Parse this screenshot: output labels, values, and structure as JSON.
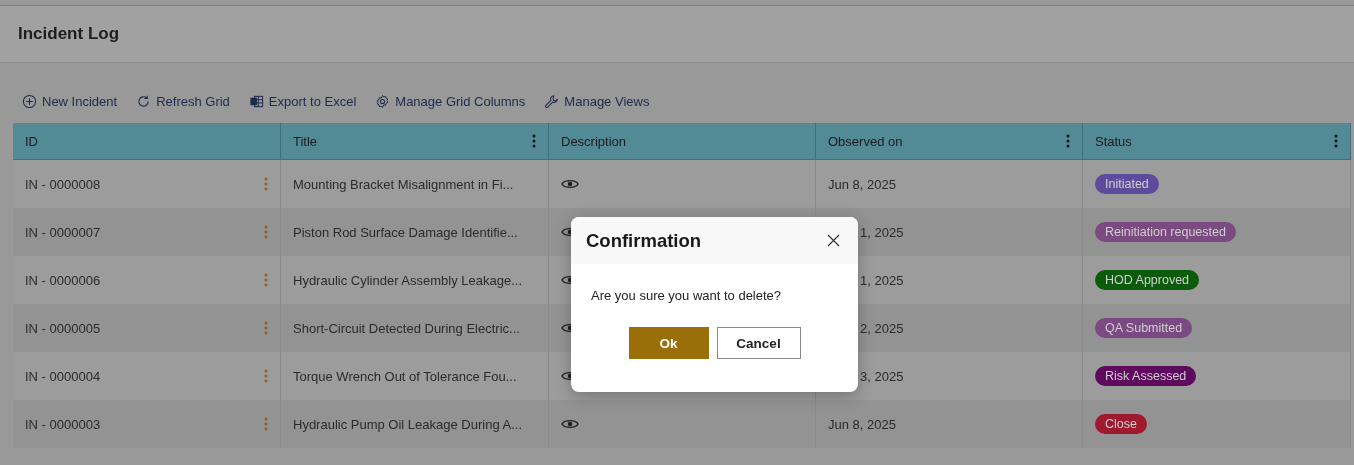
{
  "page": {
    "title": "Incident Log"
  },
  "toolbar": [
    {
      "kind": "add",
      "label": "New Incident"
    },
    {
      "kind": "refresh",
      "label": "Refresh Grid"
    },
    {
      "kind": "excel",
      "label": "Export to Excel"
    },
    {
      "kind": "gear",
      "label": "Manage Grid Columns"
    },
    {
      "kind": "wrench",
      "label": "Manage Views"
    }
  ],
  "table": {
    "columns": [
      {
        "label": "ID",
        "menu": false
      },
      {
        "label": "Title",
        "menu": true
      },
      {
        "label": "Description",
        "menu": false
      },
      {
        "label": "Observed on",
        "menu": true
      },
      {
        "label": "Status",
        "menu": true
      }
    ],
    "rows": [
      {
        "id": "IN - 0000008",
        "title": "Mounting Bracket Misalignment in Fi...",
        "observed_on": "Jun 8, 2025",
        "under_dialog": false,
        "status": "Initiated",
        "color": "#5f4b9b"
      },
      {
        "id": "IN - 0000007",
        "title": "Piston Rod Surface Damage Identifie...",
        "observed_on": "1, 2025",
        "under_dialog": true,
        "status": "Reinitiation requested",
        "color": "#7a4a80"
      },
      {
        "id": "IN - 0000006",
        "title": "Hydraulic Cylinder Assembly Leakage...",
        "observed_on": "1, 2025",
        "under_dialog": true,
        "status": "HOD Approved",
        "color": "#0a5c0a"
      },
      {
        "id": "IN - 0000005",
        "title": "Short-Circuit Detected During Electric...",
        "observed_on": "2, 2025",
        "under_dialog": true,
        "status": "QA Submitted",
        "color": "#7b4a84"
      },
      {
        "id": "IN - 0000004",
        "title": "Torque Wrench Out of Tolerance Fou...",
        "observed_on": "3, 2025",
        "under_dialog": true,
        "status": "Risk Assessed",
        "color": "#5e0a5e"
      },
      {
        "id": "IN - 0000003",
        "title": "Hydraulic Pump Oil Leakage During A...",
        "observed_on": "Jun 8, 2025",
        "under_dialog": false,
        "status": "Close",
        "color": "#a0192e"
      }
    ]
  },
  "dialog": {
    "title": "Confirmation",
    "message": "Are you sure you want to delete?",
    "ok": "Ok",
    "cancel": "Cancel"
  }
}
